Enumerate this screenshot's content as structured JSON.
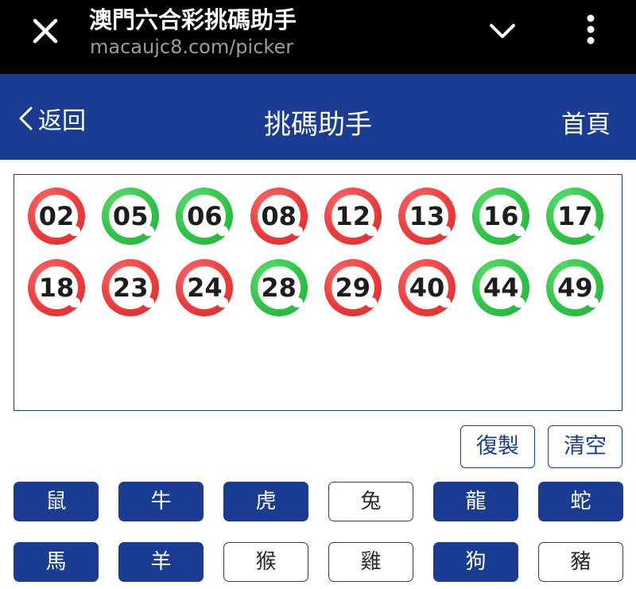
{
  "browser": {
    "title": "澳門六合彩挑碼助手",
    "url": "macaujc8.com/picker",
    "icons": {
      "close": "close-icon",
      "chevron": "chevron-down-icon",
      "more": "more-vertical-icon"
    }
  },
  "header": {
    "back_label": "返回",
    "title": "挑碼助手",
    "home_label": "首頁",
    "bg_color": "#1a3c92"
  },
  "picked_numbers": [
    {
      "num": "02",
      "color": "red"
    },
    {
      "num": "05",
      "color": "green"
    },
    {
      "num": "06",
      "color": "green"
    },
    {
      "num": "08",
      "color": "red"
    },
    {
      "num": "12",
      "color": "red"
    },
    {
      "num": "13",
      "color": "red"
    },
    {
      "num": "16",
      "color": "green"
    },
    {
      "num": "17",
      "color": "green"
    },
    {
      "num": "18",
      "color": "red"
    },
    {
      "num": "23",
      "color": "red"
    },
    {
      "num": "24",
      "color": "red"
    },
    {
      "num": "28",
      "color": "green"
    },
    {
      "num": "29",
      "color": "red"
    },
    {
      "num": "40",
      "color": "red"
    },
    {
      "num": "44",
      "color": "green"
    },
    {
      "num": "49",
      "color": "green"
    }
  ],
  "actions": {
    "copy_label": "復製",
    "clear_label": "清空"
  },
  "zodiacs": [
    {
      "label": "鼠",
      "selected": true
    },
    {
      "label": "牛",
      "selected": true
    },
    {
      "label": "虎",
      "selected": true
    },
    {
      "label": "兔",
      "selected": false
    },
    {
      "label": "龍",
      "selected": true
    },
    {
      "label": "蛇",
      "selected": true
    },
    {
      "label": "馬",
      "selected": true
    },
    {
      "label": "羊",
      "selected": true
    },
    {
      "label": "猴",
      "selected": false
    },
    {
      "label": "雞",
      "selected": false
    },
    {
      "label": "狗",
      "selected": true
    },
    {
      "label": "豬",
      "selected": false
    }
  ],
  "colors": {
    "accent": "#1a3c92",
    "red_ball": "#ee3b3b",
    "green_ball": "#2fc447"
  }
}
